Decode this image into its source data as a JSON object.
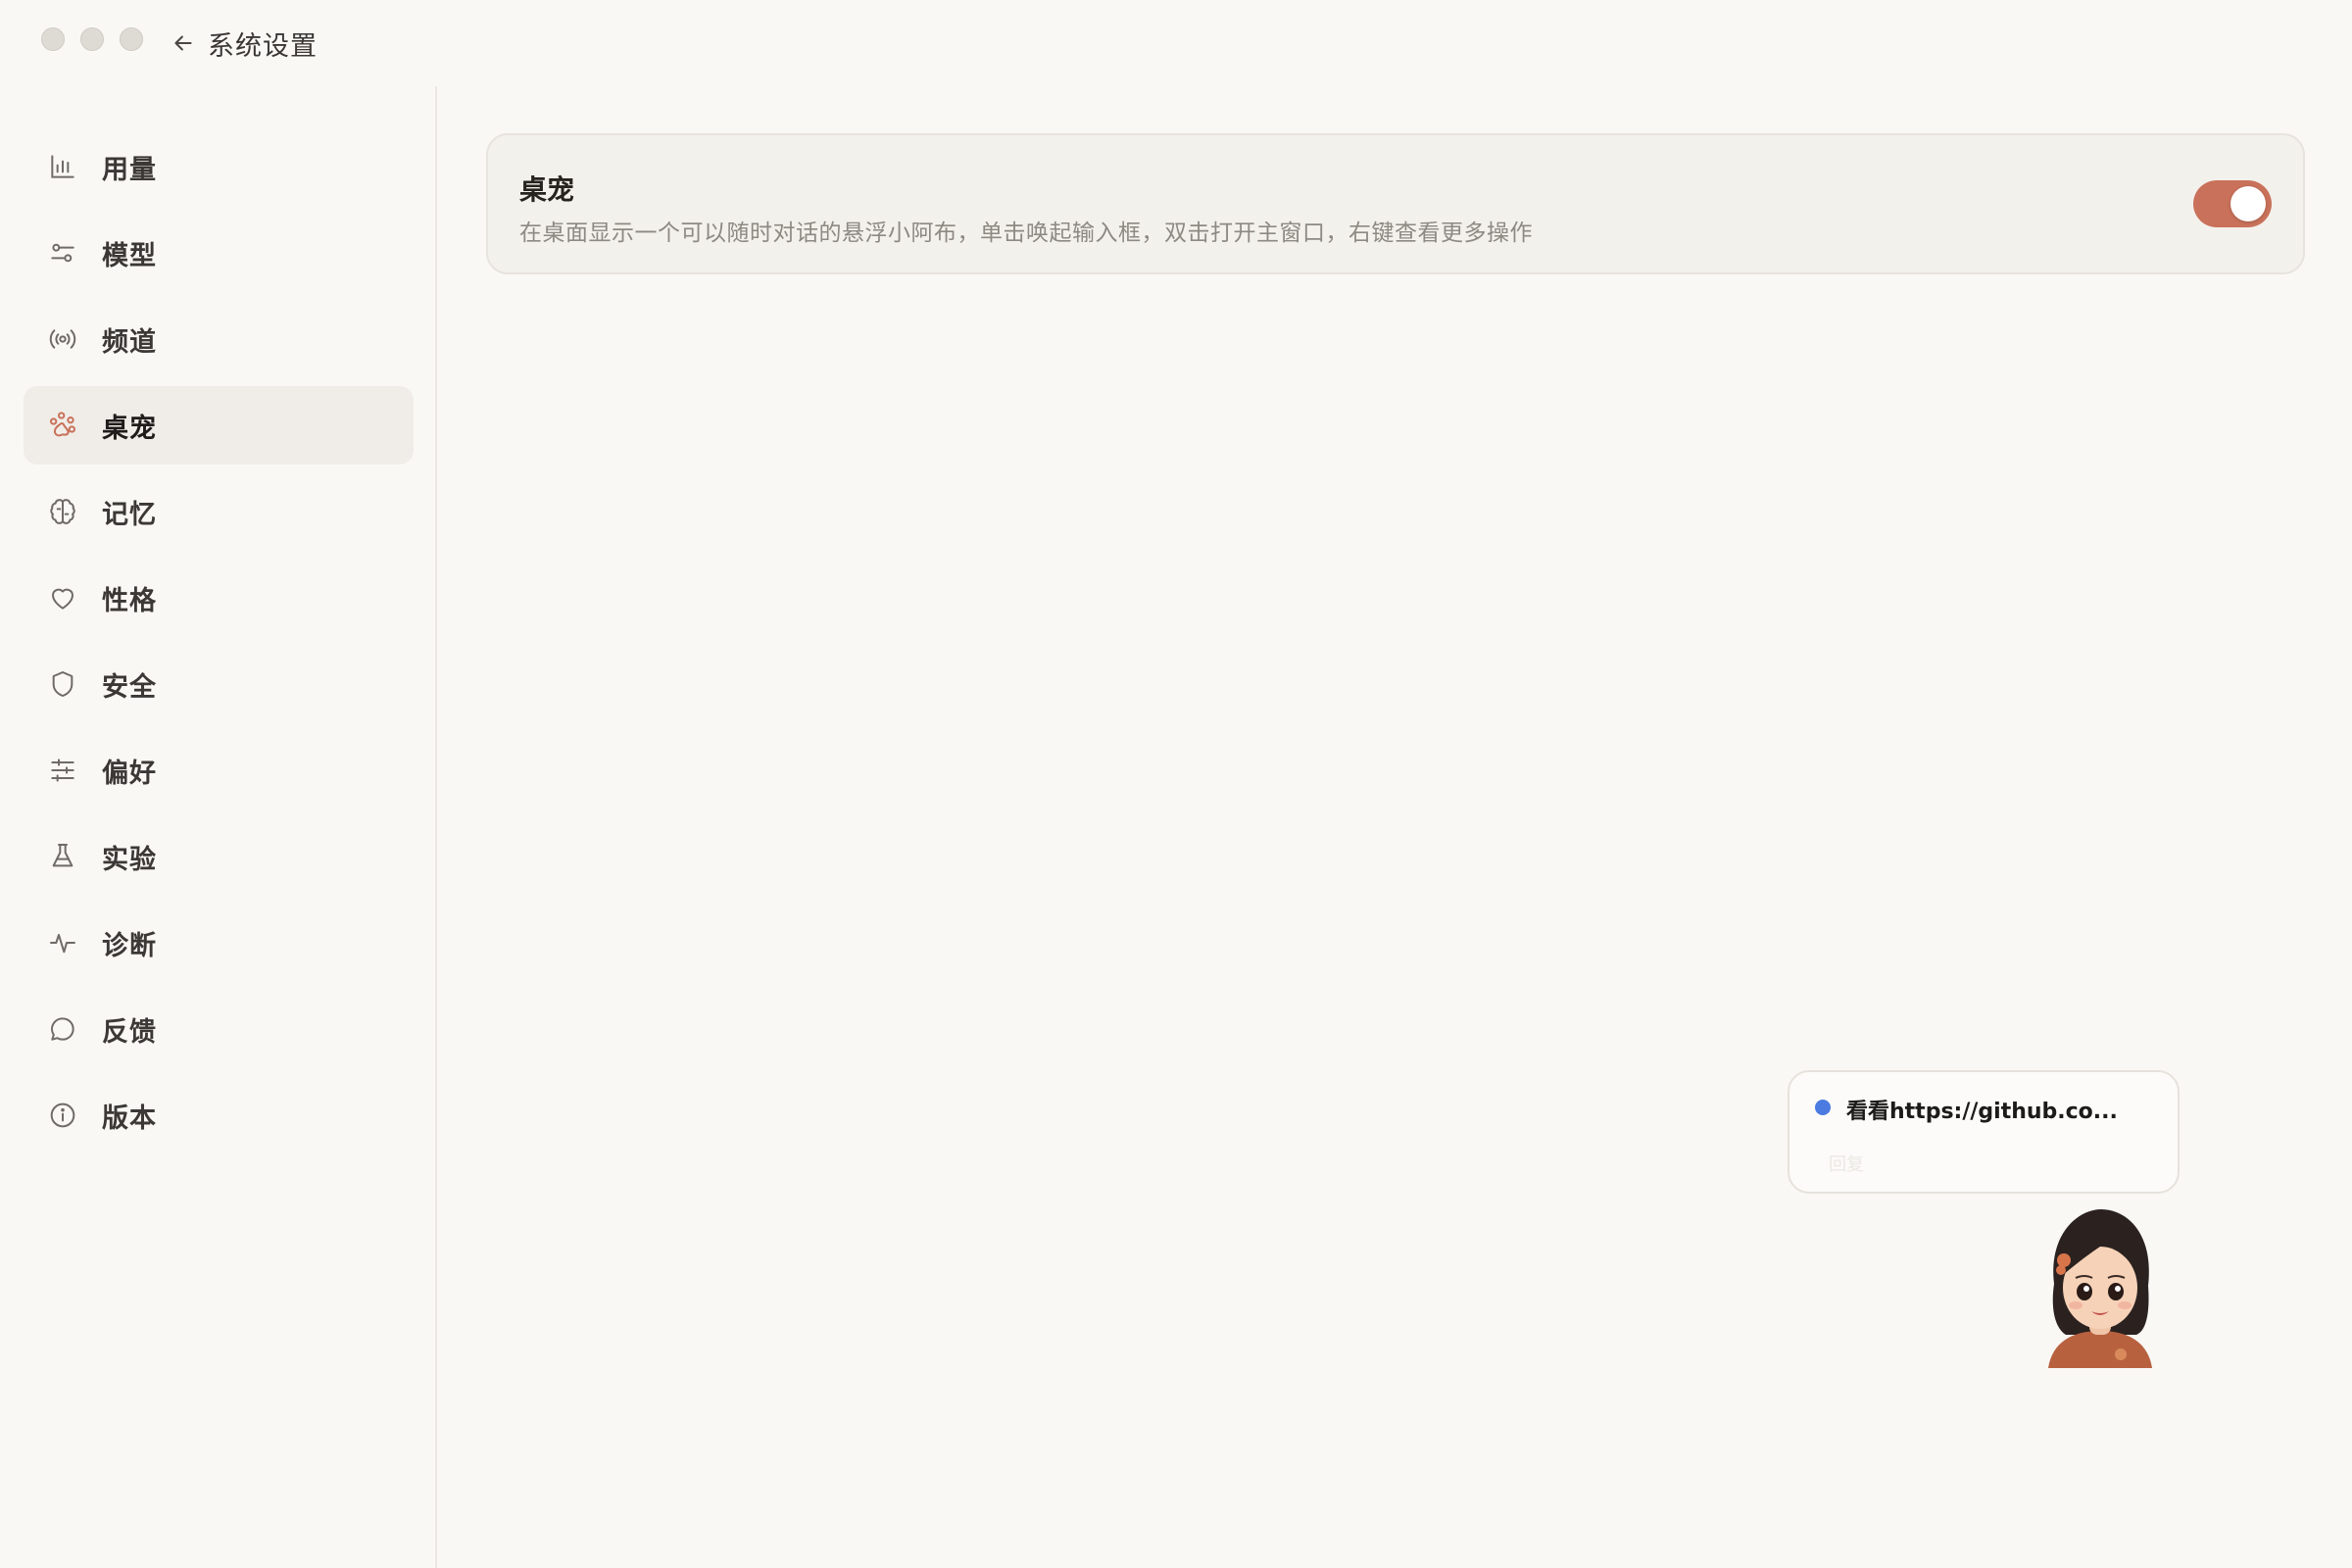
{
  "window": {
    "title": "系统设置"
  },
  "sidebar": {
    "items": [
      {
        "label": "用量",
        "icon": "bar-chart-icon"
      },
      {
        "label": "模型",
        "icon": "sliders-icon"
      },
      {
        "label": "频道",
        "icon": "broadcast-icon"
      },
      {
        "label": "桌宠",
        "icon": "paw-icon",
        "active": true
      },
      {
        "label": "记忆",
        "icon": "brain-icon"
      },
      {
        "label": "性格",
        "icon": "heart-icon"
      },
      {
        "label": "安全",
        "icon": "shield-icon"
      },
      {
        "label": "偏好",
        "icon": "tune-icon"
      },
      {
        "label": "实验",
        "icon": "flask-icon"
      },
      {
        "label": "诊断",
        "icon": "pulse-icon"
      },
      {
        "label": "反馈",
        "icon": "message-icon"
      },
      {
        "label": "版本",
        "icon": "info-icon"
      }
    ]
  },
  "setting": {
    "title": "桌宠",
    "description": "在桌面显示一个可以随时对话的悬浮小阿布，单击唤起输入框，双击打开主窗口，右键查看更多操作",
    "enabled": true
  },
  "pet": {
    "bubble_text": "看看https://github.co...",
    "bubble_sub": "回复"
  },
  "colors": {
    "accent": "#c9715a",
    "active_icon": "#c9715a",
    "background": "#f9f8f5",
    "status_dot": "#4b7ae0"
  }
}
